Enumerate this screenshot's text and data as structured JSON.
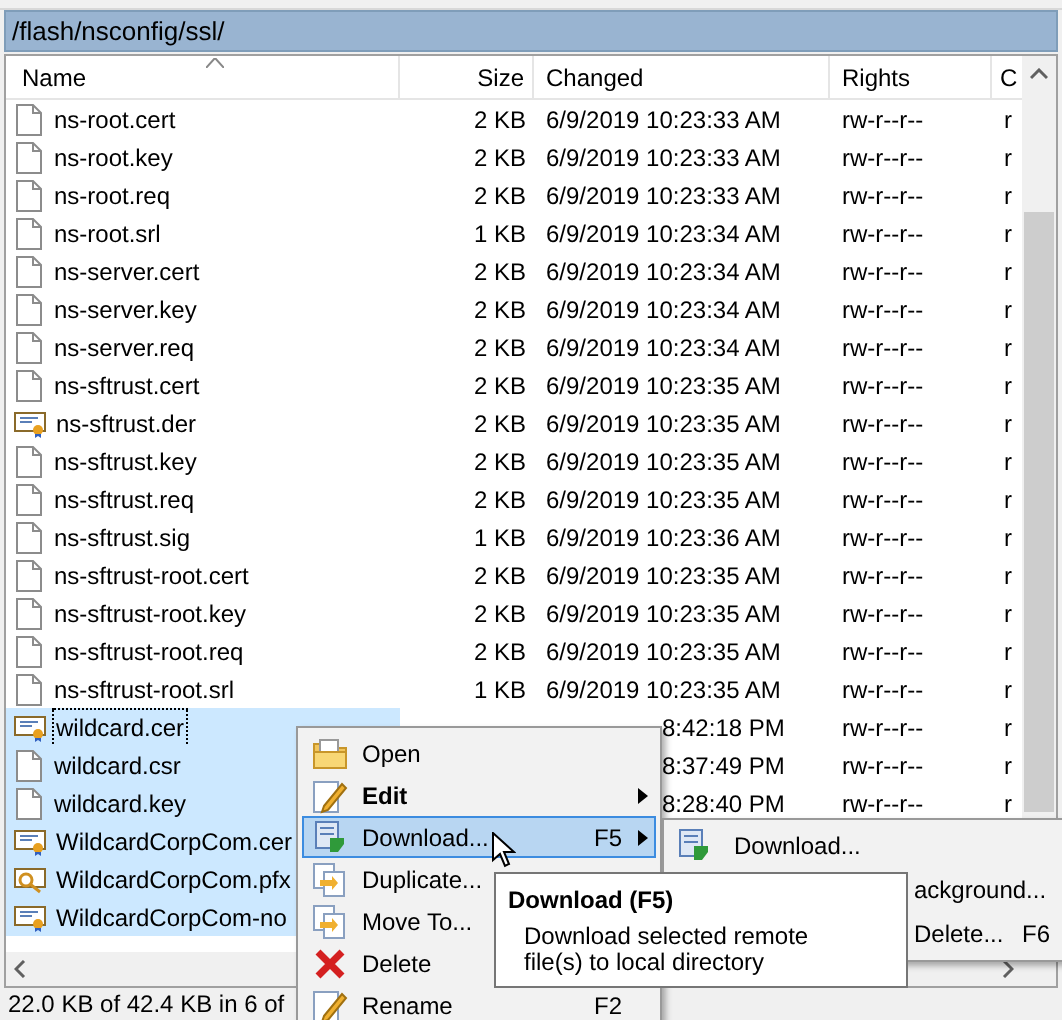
{
  "path_bar": {
    "path": "/flash/nsconfig/ssl/"
  },
  "table": {
    "columns": [
      "Name",
      "Size",
      "Changed",
      "Rights",
      "C"
    ],
    "rows": [
      {
        "kind": "file",
        "name": "ns-root.cert",
        "size": "2 KB",
        "changed": "6/9/2019 10:23:33 AM",
        "rights": "rw-r--r--",
        "column_5": "r",
        "selected": false,
        "focused": false,
        "covered": false
      },
      {
        "kind": "file",
        "name": "ns-root.key",
        "size": "2 KB",
        "changed": "6/9/2019 10:23:33 AM",
        "rights": "rw-r--r--",
        "column_5": "r",
        "selected": false,
        "focused": false,
        "covered": false
      },
      {
        "kind": "file",
        "name": "ns-root.req",
        "size": "2 KB",
        "changed": "6/9/2019 10:23:33 AM",
        "rights": "rw-r--r--",
        "column_5": "r",
        "selected": false,
        "focused": false,
        "covered": false
      },
      {
        "kind": "file",
        "name": "ns-root.srl",
        "size": "1 KB",
        "changed": "6/9/2019 10:23:34 AM",
        "rights": "rw-r--r--",
        "column_5": "r",
        "selected": false,
        "focused": false,
        "covered": false
      },
      {
        "kind": "file",
        "name": "ns-server.cert",
        "size": "2 KB",
        "changed": "6/9/2019 10:23:34 AM",
        "rights": "rw-r--r--",
        "column_5": "r",
        "selected": false,
        "focused": false,
        "covered": false
      },
      {
        "kind": "file",
        "name": "ns-server.key",
        "size": "2 KB",
        "changed": "6/9/2019 10:23:34 AM",
        "rights": "rw-r--r--",
        "column_5": "r",
        "selected": false,
        "focused": false,
        "covered": false
      },
      {
        "kind": "file",
        "name": "ns-server.req",
        "size": "2 KB",
        "changed": "6/9/2019 10:23:34 AM",
        "rights": "rw-r--r--",
        "column_5": "r",
        "selected": false,
        "focused": false,
        "covered": false
      },
      {
        "kind": "file",
        "name": "ns-sftrust.cert",
        "size": "2 KB",
        "changed": "6/9/2019 10:23:35 AM",
        "rights": "rw-r--r--",
        "column_5": "r",
        "selected": false,
        "focused": false,
        "covered": false
      },
      {
        "kind": "certificate",
        "name": "ns-sftrust.der",
        "size": "2 KB",
        "changed": "6/9/2019 10:23:35 AM",
        "rights": "rw-r--r--",
        "column_5": "r",
        "selected": false,
        "focused": false,
        "covered": false
      },
      {
        "kind": "file",
        "name": "ns-sftrust.key",
        "size": "2 KB",
        "changed": "6/9/2019 10:23:35 AM",
        "rights": "rw-r--r--",
        "column_5": "r",
        "selected": false,
        "focused": false,
        "covered": false
      },
      {
        "kind": "file",
        "name": "ns-sftrust.req",
        "size": "2 KB",
        "changed": "6/9/2019 10:23:35 AM",
        "rights": "rw-r--r--",
        "column_5": "r",
        "selected": false,
        "focused": false,
        "covered": false
      },
      {
        "kind": "file",
        "name": "ns-sftrust.sig",
        "size": "1 KB",
        "changed": "6/9/2019 10:23:36 AM",
        "rights": "rw-r--r--",
        "column_5": "r",
        "selected": false,
        "focused": false,
        "covered": false
      },
      {
        "kind": "file",
        "name": "ns-sftrust-root.cert",
        "size": "2 KB",
        "changed": "6/9/2019 10:23:35 AM",
        "rights": "rw-r--r--",
        "column_5": "r",
        "selected": false,
        "focused": false,
        "covered": false
      },
      {
        "kind": "file",
        "name": "ns-sftrust-root.key",
        "size": "2 KB",
        "changed": "6/9/2019 10:23:35 AM",
        "rights": "rw-r--r--",
        "column_5": "r",
        "selected": false,
        "focused": false,
        "covered": false
      },
      {
        "kind": "file",
        "name": "ns-sftrust-root.req",
        "size": "2 KB",
        "changed": "6/9/2019 10:23:35 AM",
        "rights": "rw-r--r--",
        "column_5": "r",
        "selected": false,
        "focused": false,
        "covered": false
      },
      {
        "kind": "file",
        "name": "ns-sftrust-root.srl",
        "size": "1 KB",
        "changed": "6/9/2019 10:23:35 AM",
        "rights": "rw-r--r--",
        "column_5": "r",
        "selected": false,
        "focused": false,
        "covered": false
      },
      {
        "kind": "certificate",
        "name": "wildcard.cer",
        "changed": "8:42:18 PM",
        "rights": "rw-r--r--",
        "column_5": "r",
        "selected": true,
        "focused": true,
        "covered": true
      },
      {
        "kind": "file",
        "name": "wildcard.csr",
        "changed": "8:37:49 PM",
        "rights": "rw-r--r--",
        "column_5": "r",
        "selected": true,
        "focused": false,
        "covered": true
      },
      {
        "kind": "file",
        "name": "wildcard.key",
        "changed": "8:28:40 PM",
        "rights": "rw-r--r--",
        "column_5": "r",
        "selected": true,
        "focused": false,
        "covered": true
      },
      {
        "kind": "certificate",
        "name": "WildcardCorpCom.cer",
        "selected": true,
        "focused": false
      },
      {
        "kind": "key-certificate",
        "name": "WildcardCorpCom.pfx",
        "selected": true,
        "focused": false
      },
      {
        "kind": "certificate",
        "name": "WildcardCorpCom-no",
        "selected": true,
        "focused": false
      }
    ]
  },
  "status_bar": {
    "text": "22.0 KB of 42.4 KB in 6 of"
  },
  "context_menu": {
    "items": [
      {
        "kind": "folder",
        "label": "Open",
        "bold": false,
        "submenu": false,
        "selected": false
      },
      {
        "kind": "pencil",
        "label": "Edit",
        "bold": true,
        "submenu": true,
        "selected": false
      },
      {
        "kind": "download",
        "label": "Download...",
        "shortcut": "F5",
        "bold": false,
        "submenu": true,
        "selected": true
      },
      {
        "kind": "copy",
        "label": "Duplicate...",
        "bold": false,
        "selected": false
      },
      {
        "kind": "copy",
        "label": "Move To...",
        "bold": false,
        "selected": false
      },
      {
        "kind": "delete",
        "label": "Delete",
        "bold": false,
        "selected": false
      },
      {
        "kind": "pencil",
        "label": "Rename",
        "shortcut": "F2",
        "bold": false,
        "selected": false
      }
    ]
  },
  "submenu": {
    "items": [
      {
        "label": "Download...",
        "covered": false
      },
      {
        "label": "ackground...",
        "covered": true
      },
      {
        "label": "Delete...",
        "shortcut": "F6",
        "covered": true
      }
    ]
  },
  "tooltip": {
    "title": "Download (F5)",
    "text": "Download selected remote file(s) to local directory"
  }
}
